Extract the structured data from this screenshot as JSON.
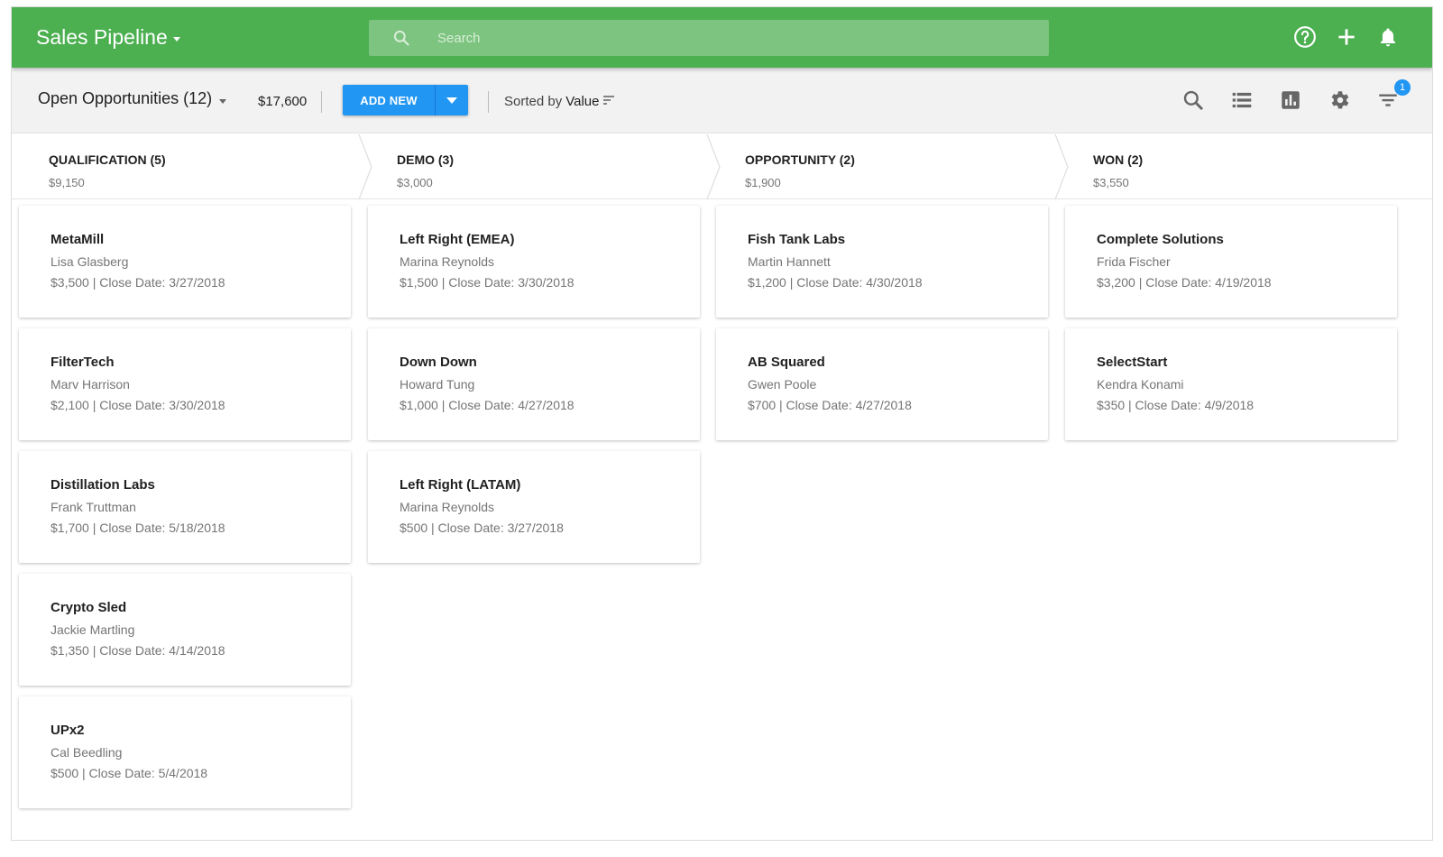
{
  "header": {
    "title": "Sales Pipeline",
    "search_placeholder": "Search",
    "icons": [
      "help-icon",
      "plus-icon",
      "bell-icon"
    ],
    "color": "#4caf50"
  },
  "toolbar": {
    "view_label": "Open Opportunities (12)",
    "total": "$17,600",
    "add_label": "ADD NEW",
    "sorted_prefix": "Sorted by",
    "sorted_value": "Value",
    "icons": [
      "search-icon",
      "list-view-icon",
      "chart-icon",
      "settings-icon",
      "filter-icon"
    ],
    "filter_badge": "1",
    "accent": "#2196f3"
  },
  "stages": [
    {
      "name": "QUALIFICATION (5)",
      "amount": "$9,150",
      "cards": [
        {
          "company": "MetaMill",
          "contact": "Lisa Glasberg",
          "detail": "$3,500 | Close Date: 3/27/2018"
        },
        {
          "company": "FilterTech",
          "contact": "Marv Harrison",
          "detail": "$2,100 | Close Date: 3/30/2018"
        },
        {
          "company": "Distillation Labs",
          "contact": "Frank Truttman",
          "detail": "$1,700 | Close Date: 5/18/2018"
        },
        {
          "company": "Crypto Sled",
          "contact": "Jackie Martling",
          "detail": "$1,350 | Close Date: 4/14/2018"
        },
        {
          "company": "UPx2",
          "contact": "Cal Beedling",
          "detail": "$500 | Close Date: 5/4/2018"
        }
      ]
    },
    {
      "name": "DEMO (3)",
      "amount": "$3,000",
      "cards": [
        {
          "company": "Left Right (EMEA)",
          "contact": "Marina Reynolds",
          "detail": "$1,500 | Close Date: 3/30/2018"
        },
        {
          "company": "Down Down",
          "contact": "Howard Tung",
          "detail": "$1,000 | Close Date: 4/27/2018"
        },
        {
          "company": "Left Right (LATAM)",
          "contact": "Marina Reynolds",
          "detail": "$500 | Close Date: 3/27/2018"
        }
      ]
    },
    {
      "name": "OPPORTUNITY (2)",
      "amount": "$1,900",
      "cards": [
        {
          "company": "Fish Tank Labs",
          "contact": "Martin Hannett",
          "detail": "$1,200 | Close Date: 4/30/2018"
        },
        {
          "company": "AB Squared",
          "contact": "Gwen Poole",
          "detail": "$700 | Close Date: 4/27/2018"
        }
      ]
    },
    {
      "name": "WON (2)",
      "amount": "$3,550",
      "cards": [
        {
          "company": "Complete Solutions",
          "contact": "Frida Fischer",
          "detail": "$3,200 | Close Date: 4/19/2018"
        },
        {
          "company": "SelectStart",
          "contact": "Kendra Konami",
          "detail": "$350 | Close Date: 4/9/2018"
        }
      ]
    }
  ]
}
